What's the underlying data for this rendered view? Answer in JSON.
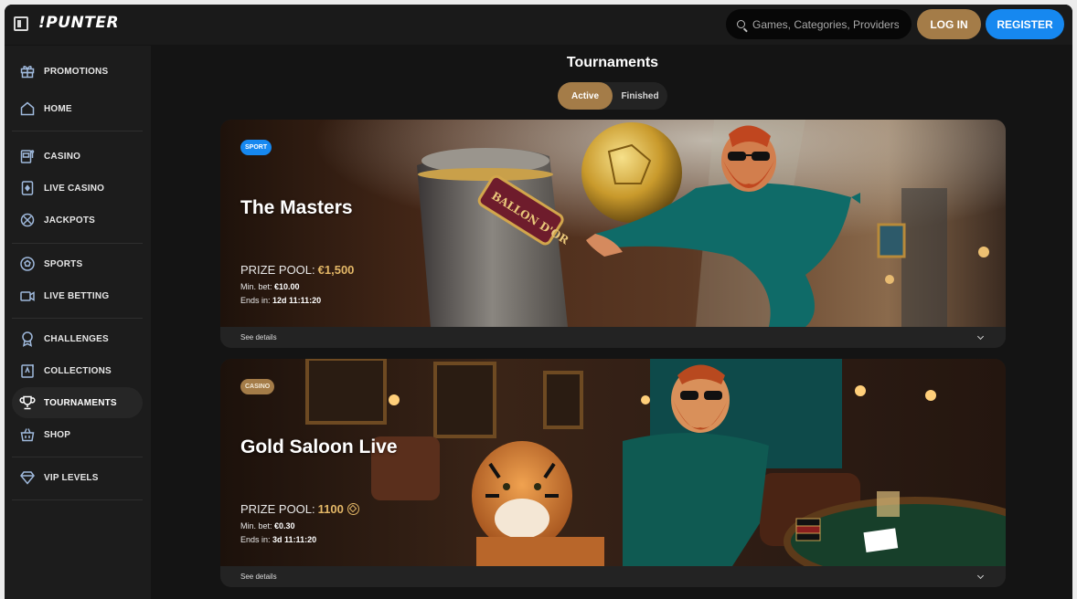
{
  "header": {
    "logo": "!PUNTER",
    "search_placeholder": "Games, Categories, Providers",
    "login_label": "LOG IN",
    "register_label": "REGISTER"
  },
  "sidebar": {
    "items": [
      {
        "label": "PROMOTIONS",
        "icon": "gift-icon"
      },
      {
        "label": "HOME",
        "icon": "home-icon"
      },
      {
        "label": "CASINO",
        "icon": "slot-machine-icon"
      },
      {
        "label": "LIVE CASINO",
        "icon": "playing-card-icon"
      },
      {
        "label": "JACKPOTS",
        "icon": "jackpot-icon"
      },
      {
        "label": "SPORTS",
        "icon": "soccer-ball-icon"
      },
      {
        "label": "LIVE BETTING",
        "icon": "video-camera-icon"
      },
      {
        "label": "CHALLENGES",
        "icon": "medal-icon"
      },
      {
        "label": "COLLECTIONS",
        "icon": "collection-card-icon"
      },
      {
        "label": "TOURNAMENTS",
        "icon": "trophy-icon"
      },
      {
        "label": "SHOP",
        "icon": "shop-basket-icon"
      },
      {
        "label": "VIP LEVELS",
        "icon": "diamond-icon"
      }
    ],
    "active": "TOURNAMENTS"
  },
  "main": {
    "title": "Tournaments",
    "tabs": [
      {
        "label": "Active",
        "active": true
      },
      {
        "label": "Finished",
        "active": false
      }
    ],
    "cards": [
      {
        "badge": "SPORT",
        "title": "The Masters",
        "prize_label": "PRIZE POOL:",
        "prize_value": "€1,500",
        "min_bet_label": "Min. bet:",
        "min_bet_value": "€10.00",
        "ends_label": "Ends in:",
        "ends_value": "12d 11:11:20",
        "trophy_text": "BALLON D'OR",
        "details_label": "See details"
      },
      {
        "badge": "CASINO",
        "title": "Gold Saloon Live",
        "prize_label": "PRIZE POOL:",
        "prize_value": "1100",
        "min_bet_label": "Min. bet:",
        "min_bet_value": "€0.30",
        "ends_label": "Ends in:",
        "ends_value": "3d 11:11:20",
        "details_label": "See details"
      }
    ]
  },
  "colors": {
    "accent_gold": "#a47c48",
    "accent_blue": "#1688f0",
    "prize_gold": "#e3b767"
  }
}
